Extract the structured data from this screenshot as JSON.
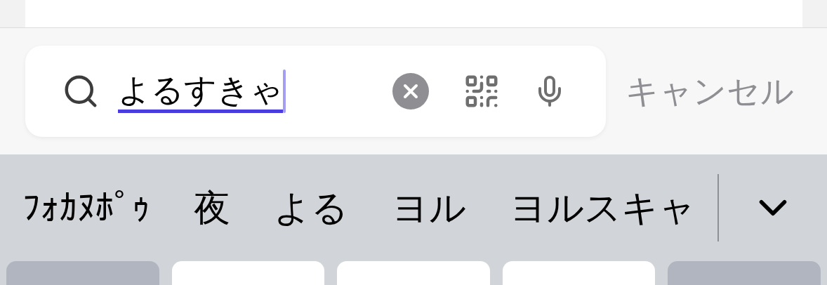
{
  "search": {
    "value": "よるすきゃ",
    "composing": true
  },
  "cancel": "キャンセル",
  "candidates": [
    {
      "label": "ﾌｫｶﾇﾎﾟｩ"
    },
    {
      "label": "夜"
    },
    {
      "label": "よる"
    },
    {
      "label": "ヨル"
    },
    {
      "label": "ヨルスキャ"
    }
  ],
  "keys": [
    {
      "kind": "function"
    },
    {
      "kind": "letter"
    },
    {
      "kind": "letter"
    },
    {
      "kind": "letter"
    },
    {
      "kind": "function"
    }
  ]
}
